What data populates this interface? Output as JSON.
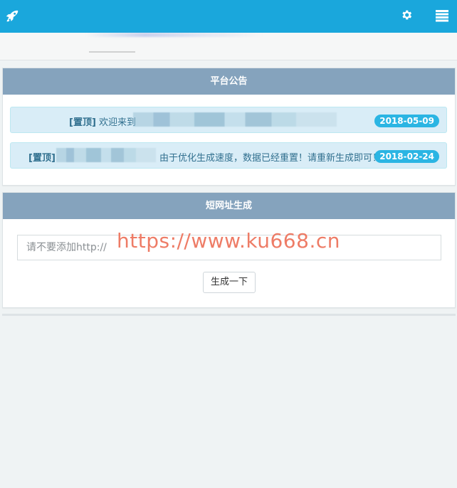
{
  "header": {
    "logo_icon": "rocket-icon",
    "settings_icon": "gear-icon",
    "menu_icon": "list-menu-icon",
    "bar_color": "#1aa7dc"
  },
  "announcements": {
    "title": "平台公告",
    "items": [
      {
        "tag": "[置顶]",
        "text": "欢迎来到",
        "date": "2018-05-09"
      },
      {
        "tag": "[置顶]",
        "text": "由于优化生成速度，数据已经重置！请重新生成即可！",
        "date": "2018-02-24"
      }
    ]
  },
  "shortener": {
    "title": "短网址生成",
    "input_placeholder": "请不要添加http://",
    "input_value": "",
    "button_label": "生成一下"
  },
  "watermark": {
    "text": "https://www.ku668.cn",
    "color": "#ee7c66"
  },
  "colors": {
    "panel_header": "#85a3bd",
    "badge": "#2bb5e3",
    "notice_bg": "#d9edf7"
  }
}
